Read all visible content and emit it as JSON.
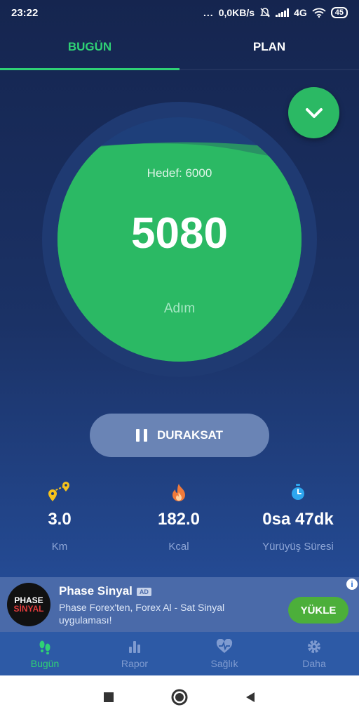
{
  "status_bar": {
    "time": "23:22",
    "dots": "...",
    "net_speed": "0,0KB/s",
    "network": "4G",
    "battery": "45"
  },
  "tabs": [
    {
      "label": "BUGÜN",
      "active": true
    },
    {
      "label": "PLAN",
      "active": false
    }
  ],
  "progress": {
    "goal_label": "Hedef: 6000",
    "steps": "5080",
    "unit_label": "Adım",
    "goal": 6000,
    "current": 5080
  },
  "pause_button": {
    "label": "DURAKSAT"
  },
  "stats": [
    {
      "value": "3.0",
      "label": "Km",
      "icon": "map-pins-icon"
    },
    {
      "value": "182.0",
      "label": "Kcal",
      "icon": "flame-icon"
    },
    {
      "value": "0sa 47dk",
      "label": "Yürüyüş Süresi",
      "icon": "stopwatch-icon"
    }
  ],
  "ad": {
    "logo_line1": "PHASE",
    "logo_line2": "SİNYAL",
    "title": "Phase Sinyal",
    "badge": "AD",
    "description": "Phase Forex'ten, Forex Al - Sat Sinyal uygulaması!",
    "button": "YÜKLE",
    "info": "i"
  },
  "bottom_nav": [
    {
      "label": "Bugün",
      "icon": "footsteps-icon",
      "active": true
    },
    {
      "label": "Rapor",
      "icon": "bar-chart-icon",
      "active": false
    },
    {
      "label": "Sağlık",
      "icon": "heartbeat-icon",
      "active": false
    },
    {
      "label": "Daha",
      "icon": "gear-icon",
      "active": false
    }
  ],
  "colors": {
    "accent": "#2fd175",
    "progress_fill": "#2bb964",
    "background": "#1b3266"
  }
}
